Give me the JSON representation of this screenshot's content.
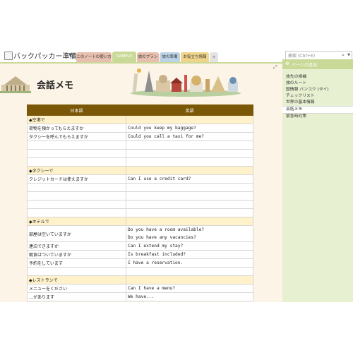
{
  "notebook": {
    "title": "バックパッカー準備ノート"
  },
  "section_tabs": [
    {
      "label": "このノートの使い方"
    },
    {
      "label": "SAMPLE"
    },
    {
      "label": "旅のプラン"
    },
    {
      "label": "旅の準備"
    },
    {
      "label": "お役立ち情報"
    },
    {
      "label": "+"
    }
  ],
  "search": {
    "placeholder": "検索 (Ctrl+E)"
  },
  "page": {
    "title": "会話メモ",
    "table": {
      "headers": [
        "日本語",
        "英語"
      ],
      "rows": [
        {
          "section": true,
          "ja": "◆空港で",
          "en": ""
        },
        {
          "ja": "荷物を預かってもらえますか",
          "en": "Could you keep my baggage?"
        },
        {
          "ja": "タクシーを呼んでもらえますか",
          "en": "Could you call a taxi for me?"
        },
        {
          "ja": "",
          "en": ""
        },
        {
          "ja": "",
          "en": ""
        },
        {
          "ja": "",
          "en": ""
        },
        {
          "section": true,
          "ja": "◆タクシーで",
          "en": ""
        },
        {
          "ja": "クレジットカードは使えますか",
          "en": "Can I use a credit card?"
        },
        {
          "ja": "",
          "en": ""
        },
        {
          "ja": "",
          "en": ""
        },
        {
          "ja": "",
          "en": ""
        },
        {
          "ja": "",
          "en": ""
        },
        {
          "section": true,
          "ja": "◆ホテルで",
          "en": ""
        },
        {
          "ja": "部屋は空いていますか",
          "en": "Do you have a room available?",
          "en2": "Do you have any vacancies?"
        },
        {
          "ja": "連泊できますか",
          "en": "Can I extend my stay?"
        },
        {
          "ja": "朝食はついていますか",
          "en": "Is breakfast included?"
        },
        {
          "ja": "予約をしています",
          "en": "I have a reservation."
        },
        {
          "ja": "",
          "en": ""
        },
        {
          "section": true,
          "ja": "◆レストランで",
          "en": ""
        },
        {
          "ja": "メニューをください",
          "en": "Can I have a menu?"
        },
        {
          "ja": "…があります",
          "en": "We have..."
        }
      ]
    }
  },
  "sidebar": {
    "add_page_label": "ページの追加",
    "pages": [
      {
        "label": "旅先の候補"
      },
      {
        "label": "旅のルート"
      },
      {
        "label": "国情報 バンコク (タイ)"
      },
      {
        "label": "チェックリスト"
      },
      {
        "label": "世界の基本情報"
      },
      {
        "label": "会話メモ",
        "active": true
      },
      {
        "label": "緊急時対策"
      }
    ]
  },
  "colors": {
    "table_header": "#7b5708",
    "section_row": "#fff1c9",
    "page_bg": "#fdf4e8",
    "sidebar_bg": "#e8f0d2",
    "accent_green": "#c9d998"
  }
}
